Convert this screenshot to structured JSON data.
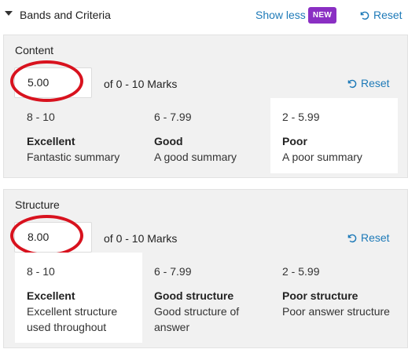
{
  "header": {
    "title": "Bands and Criteria",
    "show_less": "Show less",
    "new_badge": "NEW",
    "reset": "Reset"
  },
  "sections": [
    {
      "title": "Content",
      "score": "5.00",
      "range_text": "of 0 - 10 Marks",
      "reset": "Reset",
      "selected_band": 2,
      "bands": [
        {
          "range": "8 - 10",
          "name": "Excellent",
          "desc": "Fantastic summary"
        },
        {
          "range": "6 - 7.99",
          "name": "Good",
          "desc": "A good summary"
        },
        {
          "range": "2 - 5.99",
          "name": "Poor",
          "desc": "A poor summary"
        }
      ]
    },
    {
      "title": "Structure",
      "score": "8.00",
      "range_text": "of 0 - 10 Marks",
      "reset": "Reset",
      "selected_band": 0,
      "bands": [
        {
          "range": "8 - 10",
          "name": "Excellent",
          "desc": "Excellent structure used throughout"
        },
        {
          "range": "6 - 7.99",
          "name": "Good structure",
          "desc": "Good structure of answer"
        },
        {
          "range": "2 - 5.99",
          "name": "Poor structure",
          "desc": "Poor answer structure"
        }
      ]
    }
  ],
  "colors": {
    "link": "#1e7ab8",
    "badge": "#8a2fc3",
    "annotation_circle": "#d8121e",
    "panel_bg": "#f1f1f1",
    "selected_band_bg": "#ffffff"
  },
  "icons": {
    "collapse": "caret-down-icon",
    "reset": "undo-icon"
  }
}
